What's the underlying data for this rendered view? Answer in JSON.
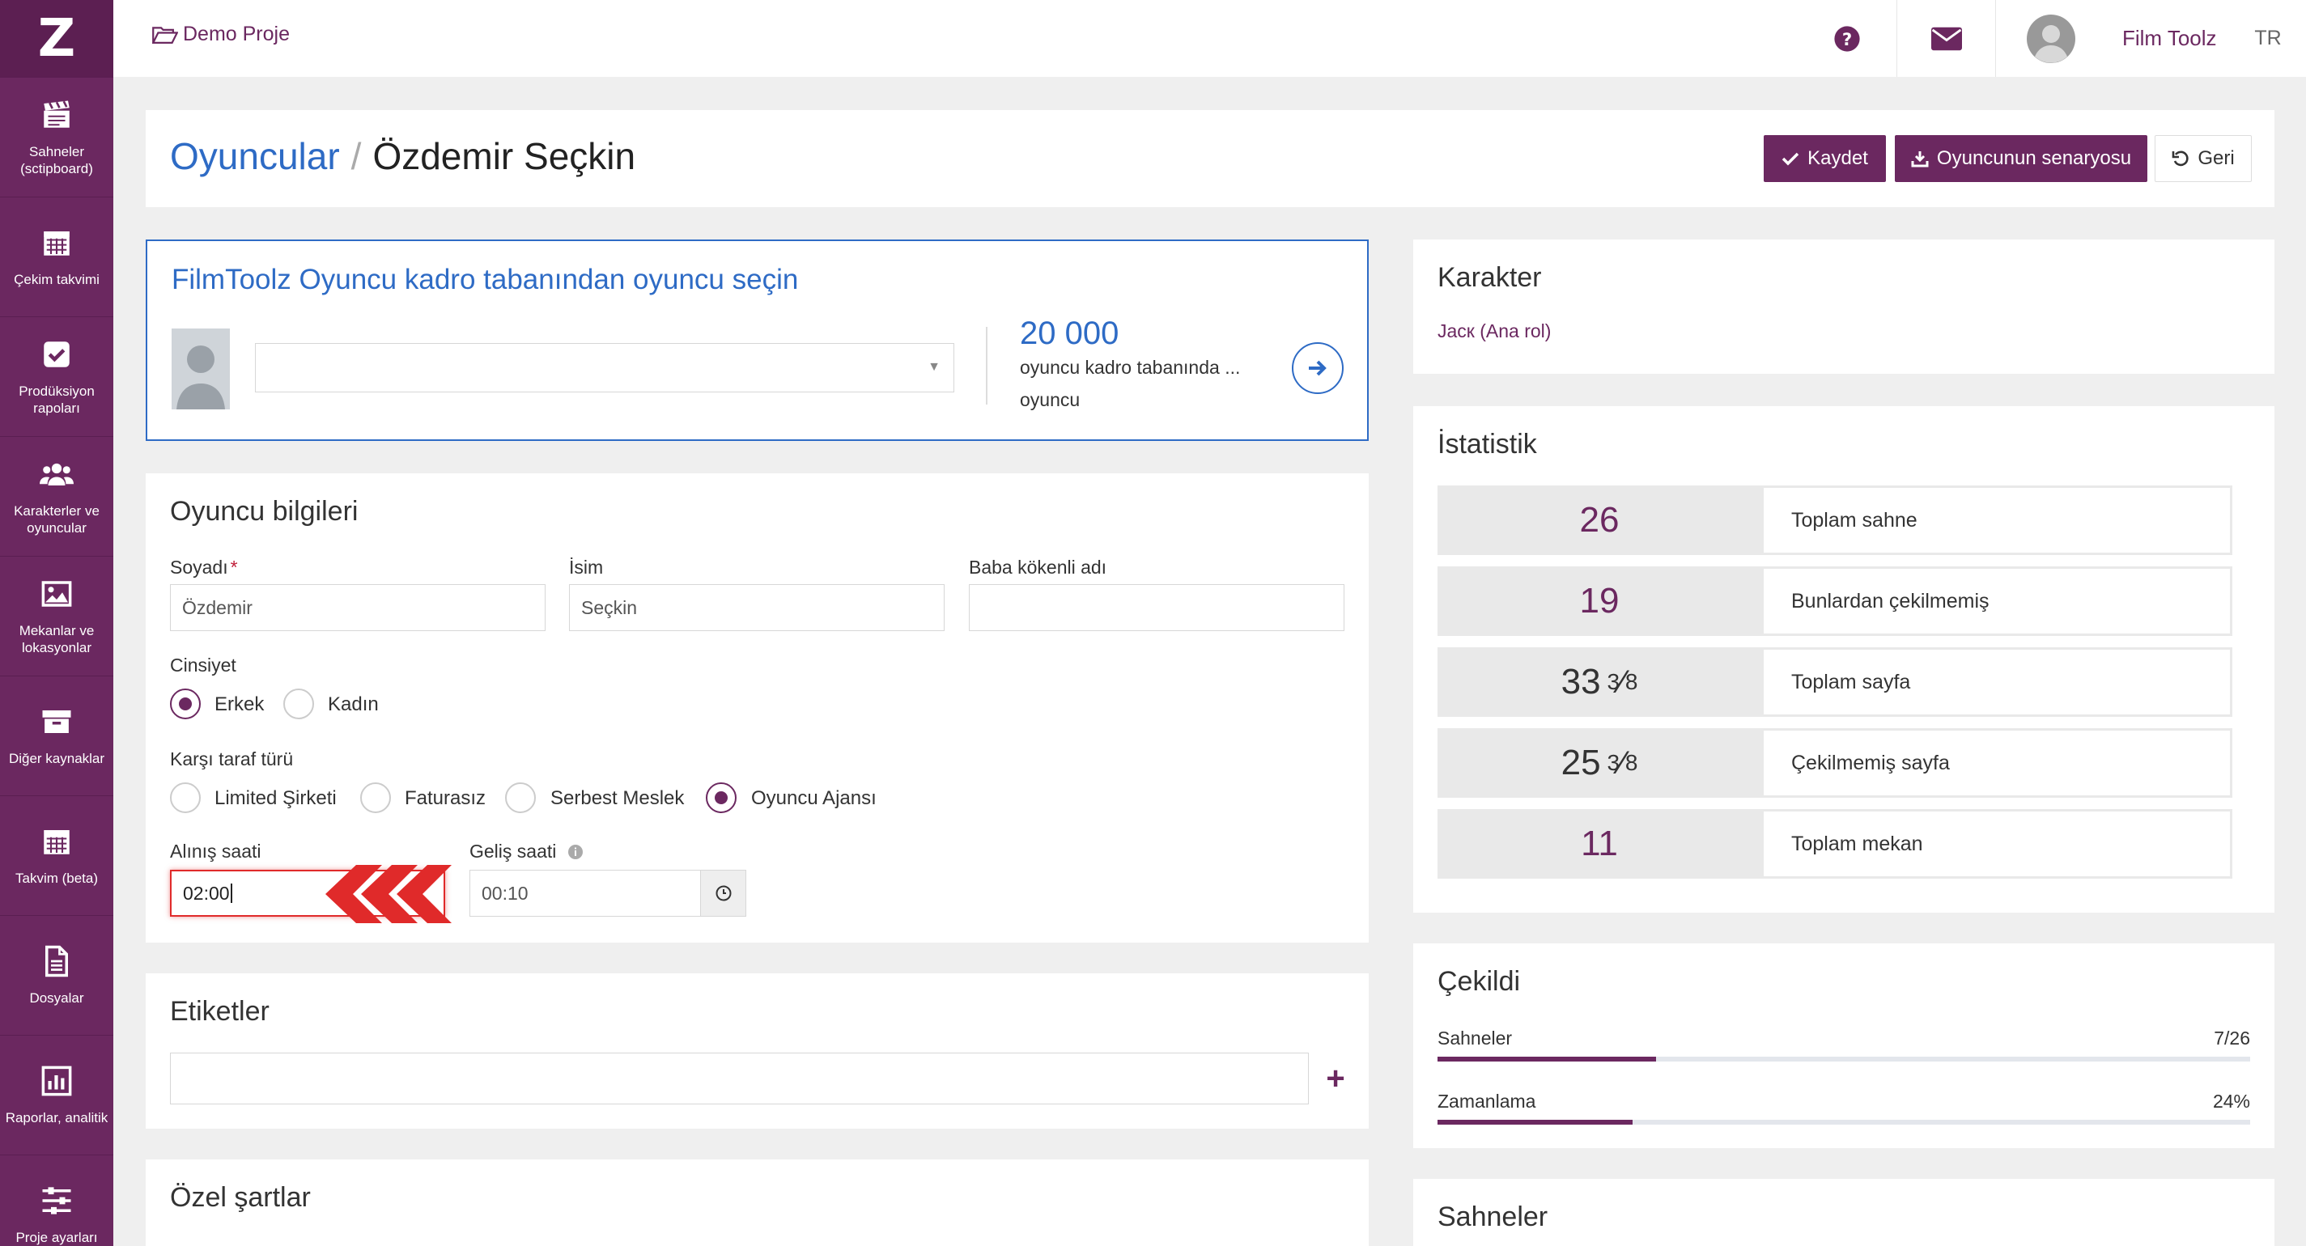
{
  "sidebar": {
    "logo": "Z",
    "items": [
      {
        "label": "Sahneler (sctipboard)",
        "icon": "clapperboard-icon"
      },
      {
        "label": "Çekim takvimi",
        "icon": "calendar-icon"
      },
      {
        "label": "Prodüksiyon rapoları",
        "icon": "checkbox-icon"
      },
      {
        "label": "Karakterler ve oyuncular",
        "icon": "users-icon"
      },
      {
        "label": "Mekanlar ve lokasyonlar",
        "icon": "image-icon"
      },
      {
        "label": "Diğer kaynaklar",
        "icon": "archive-icon"
      },
      {
        "label": "Takvim (beta)",
        "icon": "calendar-icon"
      },
      {
        "label": "Dosyalar",
        "icon": "file-icon"
      },
      {
        "label": "Raporlar, analitik",
        "icon": "chart-icon"
      },
      {
        "label": "Proje ayarları",
        "icon": "sliders-icon"
      }
    ]
  },
  "topbar": {
    "project": "Demo Proje",
    "user": "Film Toolz",
    "lang": "TR"
  },
  "header": {
    "section": "Oyuncular",
    "separator": "/",
    "name": "Özdemir Seçkin",
    "save": "Kaydet",
    "script": "Oyuncunun senaryosu",
    "back": "Geri"
  },
  "select_panel": {
    "title": "FilmToolz Oyuncu kadro tabanından oyuncu seçin",
    "count": "20 000",
    "desc1": "oyuncu kadro tabanında ...",
    "desc2": "oyuncu"
  },
  "info": {
    "title": "Oyuncu bilgileri",
    "surname_label": "Soyadı",
    "required": "*",
    "surname": "Özdemir",
    "name_label": "İsim",
    "name": "Seçkin",
    "father_label": "Baba kökenli adı",
    "father": "",
    "gender_label": "Cinsiyet",
    "male": "Erkek",
    "female": "Kadın",
    "party_label": "Karşı taraf türü",
    "party_opts": [
      "Limited Şirketi",
      "Faturasız",
      "Serbest Meslek",
      "Oyuncu Ajansı"
    ],
    "pickup_label": "Alınış saati",
    "pickup": "02:00",
    "arrival_label": "Geliş saati",
    "arrival": "00:10"
  },
  "tags": {
    "title": "Etiketler"
  },
  "special": {
    "title": "Özel şartlar"
  },
  "character": {
    "title": "Karakter",
    "value": "Jacк (Ana rol)"
  },
  "stats": {
    "title": "İstatistik",
    "rows": [
      {
        "num": "26",
        "label": "Toplam sahne"
      },
      {
        "num": "19",
        "label": "Bunlardan çekilmemiş"
      },
      {
        "num": "33",
        "sup": "3",
        "sub": "8",
        "label": "Toplam sayfa"
      },
      {
        "num": "25",
        "sup": "3",
        "sub": "8",
        "label": "Çekilmemiş sayfa"
      },
      {
        "num": "11",
        "label": "Toplam mekan"
      }
    ]
  },
  "shot": {
    "title": "Çekildi",
    "scenes_label": "Sahneler",
    "scenes_value": "7/26",
    "scenes_fraction": 0.269,
    "timing_label": "Zamanlama",
    "timing_value": "24%",
    "timing_fraction": 0.24
  },
  "scenes": {
    "title": "Sahneler"
  },
  "colors": {
    "brand": "#6b2860",
    "link": "#2e6bc5",
    "alert": "#e02a2a"
  }
}
